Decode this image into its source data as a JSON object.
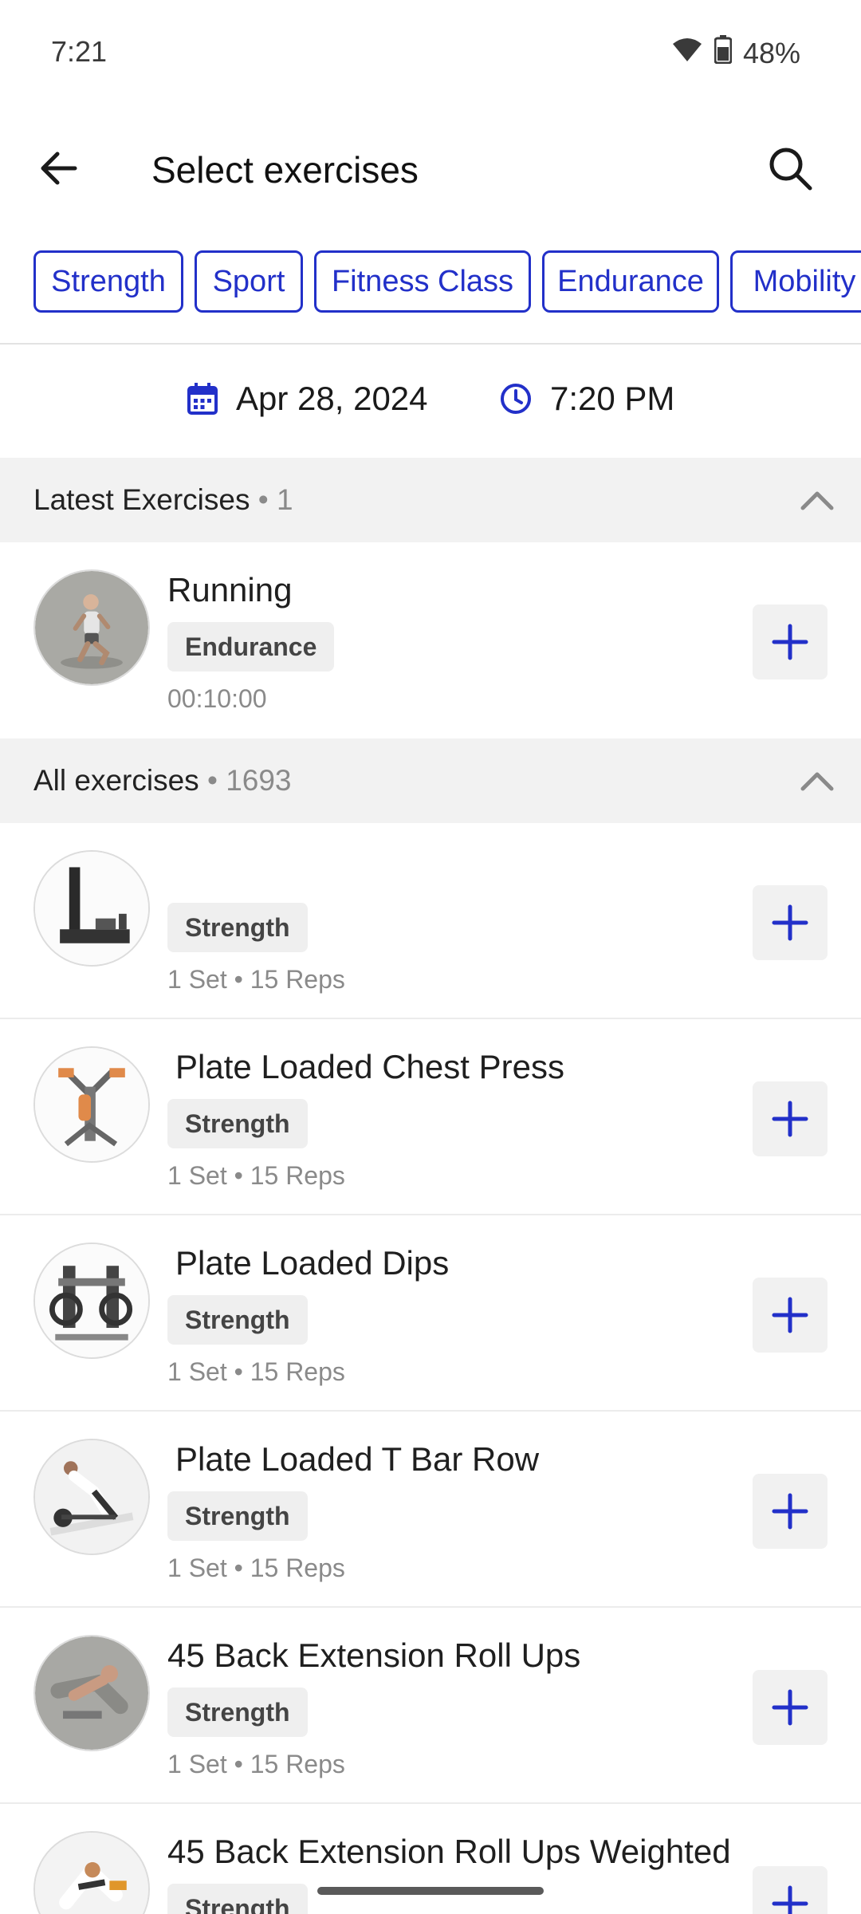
{
  "status": {
    "time": "7:21",
    "battery": "48%"
  },
  "appbar": {
    "title": "Select exercises"
  },
  "filters": [
    "Strength",
    "Sport",
    "Fitness Class",
    "Endurance",
    "Mobility"
  ],
  "datetime": {
    "date": "Apr 28, 2024",
    "time": "7:20 PM"
  },
  "latest": {
    "title": "Latest Exercises",
    "count": "• 1",
    "items": [
      {
        "name": "Running",
        "tag": "Endurance",
        "meta": "00:10:00",
        "icon": "running-figure"
      }
    ]
  },
  "all": {
    "title": "All exercises",
    "count": "• 1693",
    "items": [
      {
        "name": "",
        "tag": "Strength",
        "meta": "1 Set • 15 Reps",
        "icon": "cable-machine"
      },
      {
        "name": "Plate Loaded Chest Press",
        "tag": "Strength",
        "meta": "1 Set • 15 Reps",
        "icon": "chest-press-machine"
      },
      {
        "name": "Plate Loaded Dips",
        "tag": "Strength",
        "meta": "1 Set • 15 Reps",
        "icon": "dips-machine"
      },
      {
        "name": "Plate Loaded T Bar Row",
        "tag": "Strength",
        "meta": "1 Set • 15 Reps",
        "icon": "t-bar-row-figure"
      },
      {
        "name": "45 Back Extension Roll Ups",
        "tag": "Strength",
        "meta": "1 Set • 15 Reps",
        "icon": "back-extension-figure"
      },
      {
        "name": "45 Back Extension Roll Ups Weighted",
        "tag": "Strength",
        "meta": "",
        "icon": "back-extension-weighted-figure"
      }
    ]
  },
  "colors": {
    "accent": "#2230c9",
    "section_bg": "#f2f2f2",
    "tag_bg": "#efefef"
  }
}
